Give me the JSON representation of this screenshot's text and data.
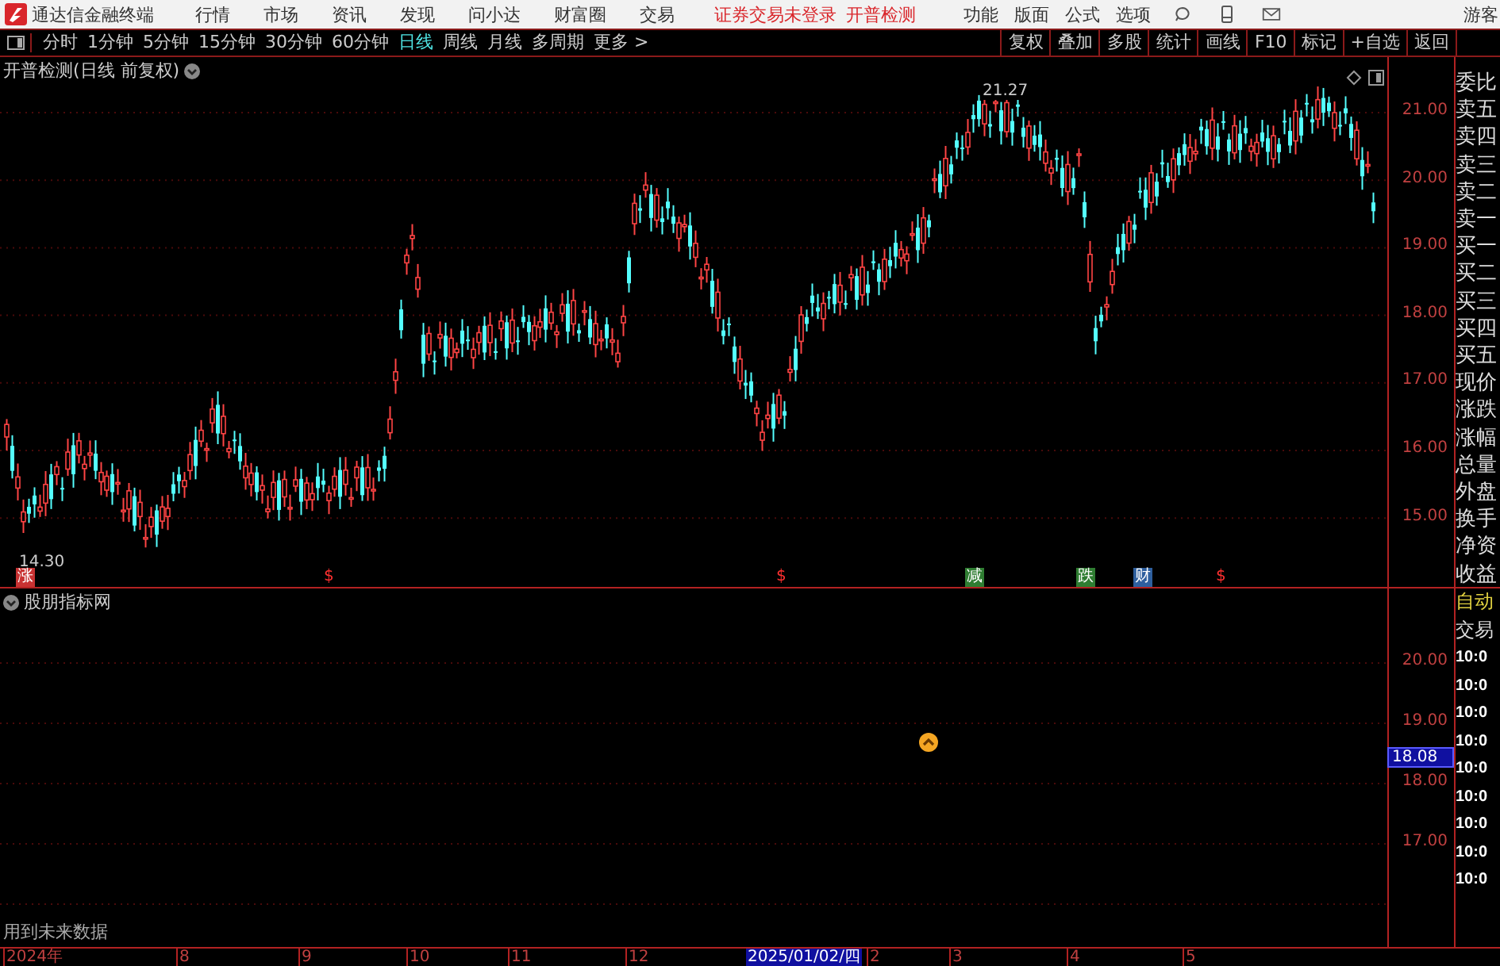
{
  "menu_bar": {
    "app_name": "通达信金融终端",
    "menus": [
      "行情",
      "市场",
      "资讯",
      "发现",
      "问小达",
      "财富圈",
      "交易"
    ],
    "login_status": "证券交易未登录",
    "stock_name": "开普检测",
    "tools": [
      "功能",
      "版面",
      "公式",
      "选项"
    ],
    "user": "游客"
  },
  "period_bar": {
    "periods": [
      {
        "label": "分时",
        "selected": false
      },
      {
        "label": "1分钟",
        "selected": false
      },
      {
        "label": "5分钟",
        "selected": false
      },
      {
        "label": "15分钟",
        "selected": false
      },
      {
        "label": "30分钟",
        "selected": false
      },
      {
        "label": "60分钟",
        "selected": false
      },
      {
        "label": "日线",
        "selected": true
      },
      {
        "label": "周线",
        "selected": false
      },
      {
        "label": "月线",
        "selected": false
      },
      {
        "label": "多周期",
        "selected": false
      },
      {
        "label": "更多 >",
        "selected": false
      }
    ],
    "actions": [
      "复权",
      "叠加",
      "多股",
      "统计",
      "画线",
      "F10",
      "标记",
      "+自选",
      "返回"
    ]
  },
  "main_chart": {
    "title": "开普检测(日线 前复权)",
    "high_label": "21.27",
    "low_label": "14.30",
    "y_labels": [
      "21.00",
      "20.00",
      "19.00",
      "18.00",
      "17.00",
      "16.00",
      "15.00"
    ],
    "markers": [
      {
        "text": "涨",
        "kind": "badge",
        "color": "#c83232"
      },
      {
        "text": "$",
        "kind": "plain",
        "color": "#ff3030"
      },
      {
        "text": "$",
        "kind": "plain",
        "color": "#ff3030"
      },
      {
        "text": "减",
        "kind": "badge",
        "color": "#2f7d32"
      },
      {
        "text": "跌",
        "kind": "badge",
        "color": "#2f7d32"
      },
      {
        "text": "财",
        "kind": "badge",
        "color": "#2e5f9e"
      },
      {
        "text": "$",
        "kind": "plain",
        "color": "#ff3030"
      }
    ]
  },
  "quote_panel": {
    "labels": [
      "委比",
      "卖五",
      "卖四",
      "卖三",
      "卖二",
      "卖一",
      "买一",
      "买二",
      "买三",
      "买四",
      "买五",
      "现价",
      "涨跌",
      "涨幅",
      "总量",
      "外盘",
      "换手",
      "净资",
      "收益"
    ]
  },
  "indicator_pane": {
    "title": "股朋指标网",
    "y_labels": [
      "20.00",
      "19.00",
      "18.00",
      "17.00"
    ],
    "cursor_value": "18.08",
    "footnote": "用到未来数据",
    "side_rows": [
      {
        "text": "自动",
        "kind": "highlight"
      },
      {
        "text": "交易",
        "kind": "plain"
      },
      {
        "text": "10:0",
        "kind": "time"
      },
      {
        "text": "10:0",
        "kind": "time"
      },
      {
        "text": "10:0",
        "kind": "time"
      },
      {
        "text": "10:0",
        "kind": "time"
      },
      {
        "text": "10:0",
        "kind": "time"
      },
      {
        "text": "10:0",
        "kind": "time"
      },
      {
        "text": "10:0",
        "kind": "time"
      },
      {
        "text": "10:0",
        "kind": "time"
      },
      {
        "text": "10:0",
        "kind": "time"
      }
    ]
  },
  "time_axis": [
    {
      "label": "2024年",
      "selected": false
    },
    {
      "label": "8",
      "selected": false
    },
    {
      "label": "9",
      "selected": false
    },
    {
      "label": "10",
      "selected": false
    },
    {
      "label": "11",
      "selected": false
    },
    {
      "label": "12",
      "selected": false
    },
    {
      "label": "2025/01/02/四",
      "selected": true
    },
    {
      "label": "2",
      "selected": false
    },
    {
      "label": "3",
      "selected": false
    },
    {
      "label": "4",
      "selected": false
    },
    {
      "label": "5",
      "selected": false
    }
  ]
}
